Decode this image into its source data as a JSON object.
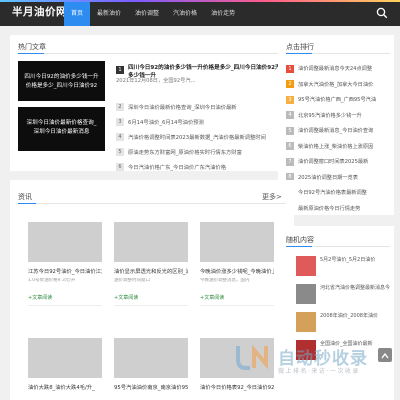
{
  "header": {
    "logo": "半月油价网",
    "nav": [
      "首页",
      "最新油价",
      "油价调整",
      "汽油价格",
      "油价走势"
    ],
    "colors": {
      "bar": "#2b2b2b",
      "accent": "#2d8cf0"
    }
  },
  "hot": {
    "title": "热门文章",
    "cards": [
      {
        "line1": "四川今日92的油价多少钱一升",
        "line2": "价格是多少_四川今日油价92"
      },
      {
        "line1": "深圳今日油价最新价格查询_",
        "line2": "深圳今日油价最新消息"
      }
    ],
    "feature": {
      "num": "1",
      "title": "四川今日92的油价多少钱一升价格是多少_四川今日油价92汽油多少钱一升",
      "date": "2021年12月08日，全国92号汽..."
    },
    "list": [
      {
        "num": "2",
        "text": "深圳今日油价最新价格查询_深圳今日油价最新"
      },
      {
        "num": "3",
        "text": "6月14号油价_6月14号油价预测"
      },
      {
        "num": "4",
        "text": "汽油价格调整时间表2023最新数据_汽油价格最新调整时间"
      },
      {
        "num": "5",
        "text": "原油走势东方财富网_原油价格实时行情东方财富"
      },
      {
        "num": "6",
        "text": "今日汽油价格广东_今日油价广东汽油价格"
      }
    ]
  },
  "sidebar": {
    "title": "点击排行",
    "items": [
      {
        "num": "1",
        "text": "油价调整最新消息今天24点调整",
        "color": "#e74c3c"
      },
      {
        "num": "2",
        "text": "加拿大汽油价格_加拿大今日油价",
        "color": "#f39c12"
      },
      {
        "num": "3",
        "text": "95号汽油价格广西_广西95号汽油",
        "color": "#f5b041"
      },
      {
        "num": "4",
        "text": "北京95汽油价格多少钱一升",
        "color": "#bbbbbb"
      },
      {
        "num": "5",
        "text": "油价调整最新消息_今日油价查询",
        "color": "#bbbbbb"
      },
      {
        "num": "6",
        "text": "柴油价格上涨_柴油价格上涨原因",
        "color": "#bbbbbb"
      },
      {
        "num": "7",
        "text": "油价调整窗口时间表2025最新",
        "color": "#bbbbbb"
      },
      {
        "num": "8",
        "text": "2025油价调整日期一览表",
        "color": "#bbbbbb"
      },
      {
        "num": "9",
        "text": "今日92号汽油价格表最新调整",
        "color": "#bbbbbb"
      },
      {
        "num": "10",
        "text": "最新原油价格今日行情走势",
        "color": "#bbbbbb"
      }
    ]
  },
  "articles": {
    "title": "资讯",
    "more": "更多>",
    "row1": [
      {
        "title": "江苏今日92号油价_今日油价江苏",
        "desc": "1.0号柴油价格9.3元/升",
        "tag": "+文章阅读"
      },
      {
        "title": "油价显示屏透光和反光的区别_油价",
        "desc": "油价调整时间窗口",
        "tag": "+文章阅读"
      },
      {
        "title": "今晚油价涨多少钱呢_今晚油价上",
        "desc": "今晚油价调整消息，国内",
        "tag": "+文章阅读"
      }
    ],
    "row2": [
      {
        "title": "油价大跌8_油价大跌4毛/升_"
      },
      {
        "title": "95号汽油油价南京_南京油价95"
      },
      {
        "title": "油价今日价格表92_今日油价92"
      }
    ]
  },
  "random": {
    "title": "随机内容",
    "items": [
      {
        "text": "5月2号油价_5月2日油价",
        "color": "#e05a5a"
      },
      {
        "text": "河北省汽油价格调整最新消息今",
        "color": "#8a8a8a"
      },
      {
        "text": "2008年油价_2008年油价",
        "color": "#d4a05a"
      },
      {
        "text": "全国油价_全国油价最新",
        "color": "#b03030"
      }
    ]
  },
  "watermark": {
    "main": "自动秒收录",
    "sub": "做上排名·来访·一次收录",
    "logo": "JN"
  }
}
